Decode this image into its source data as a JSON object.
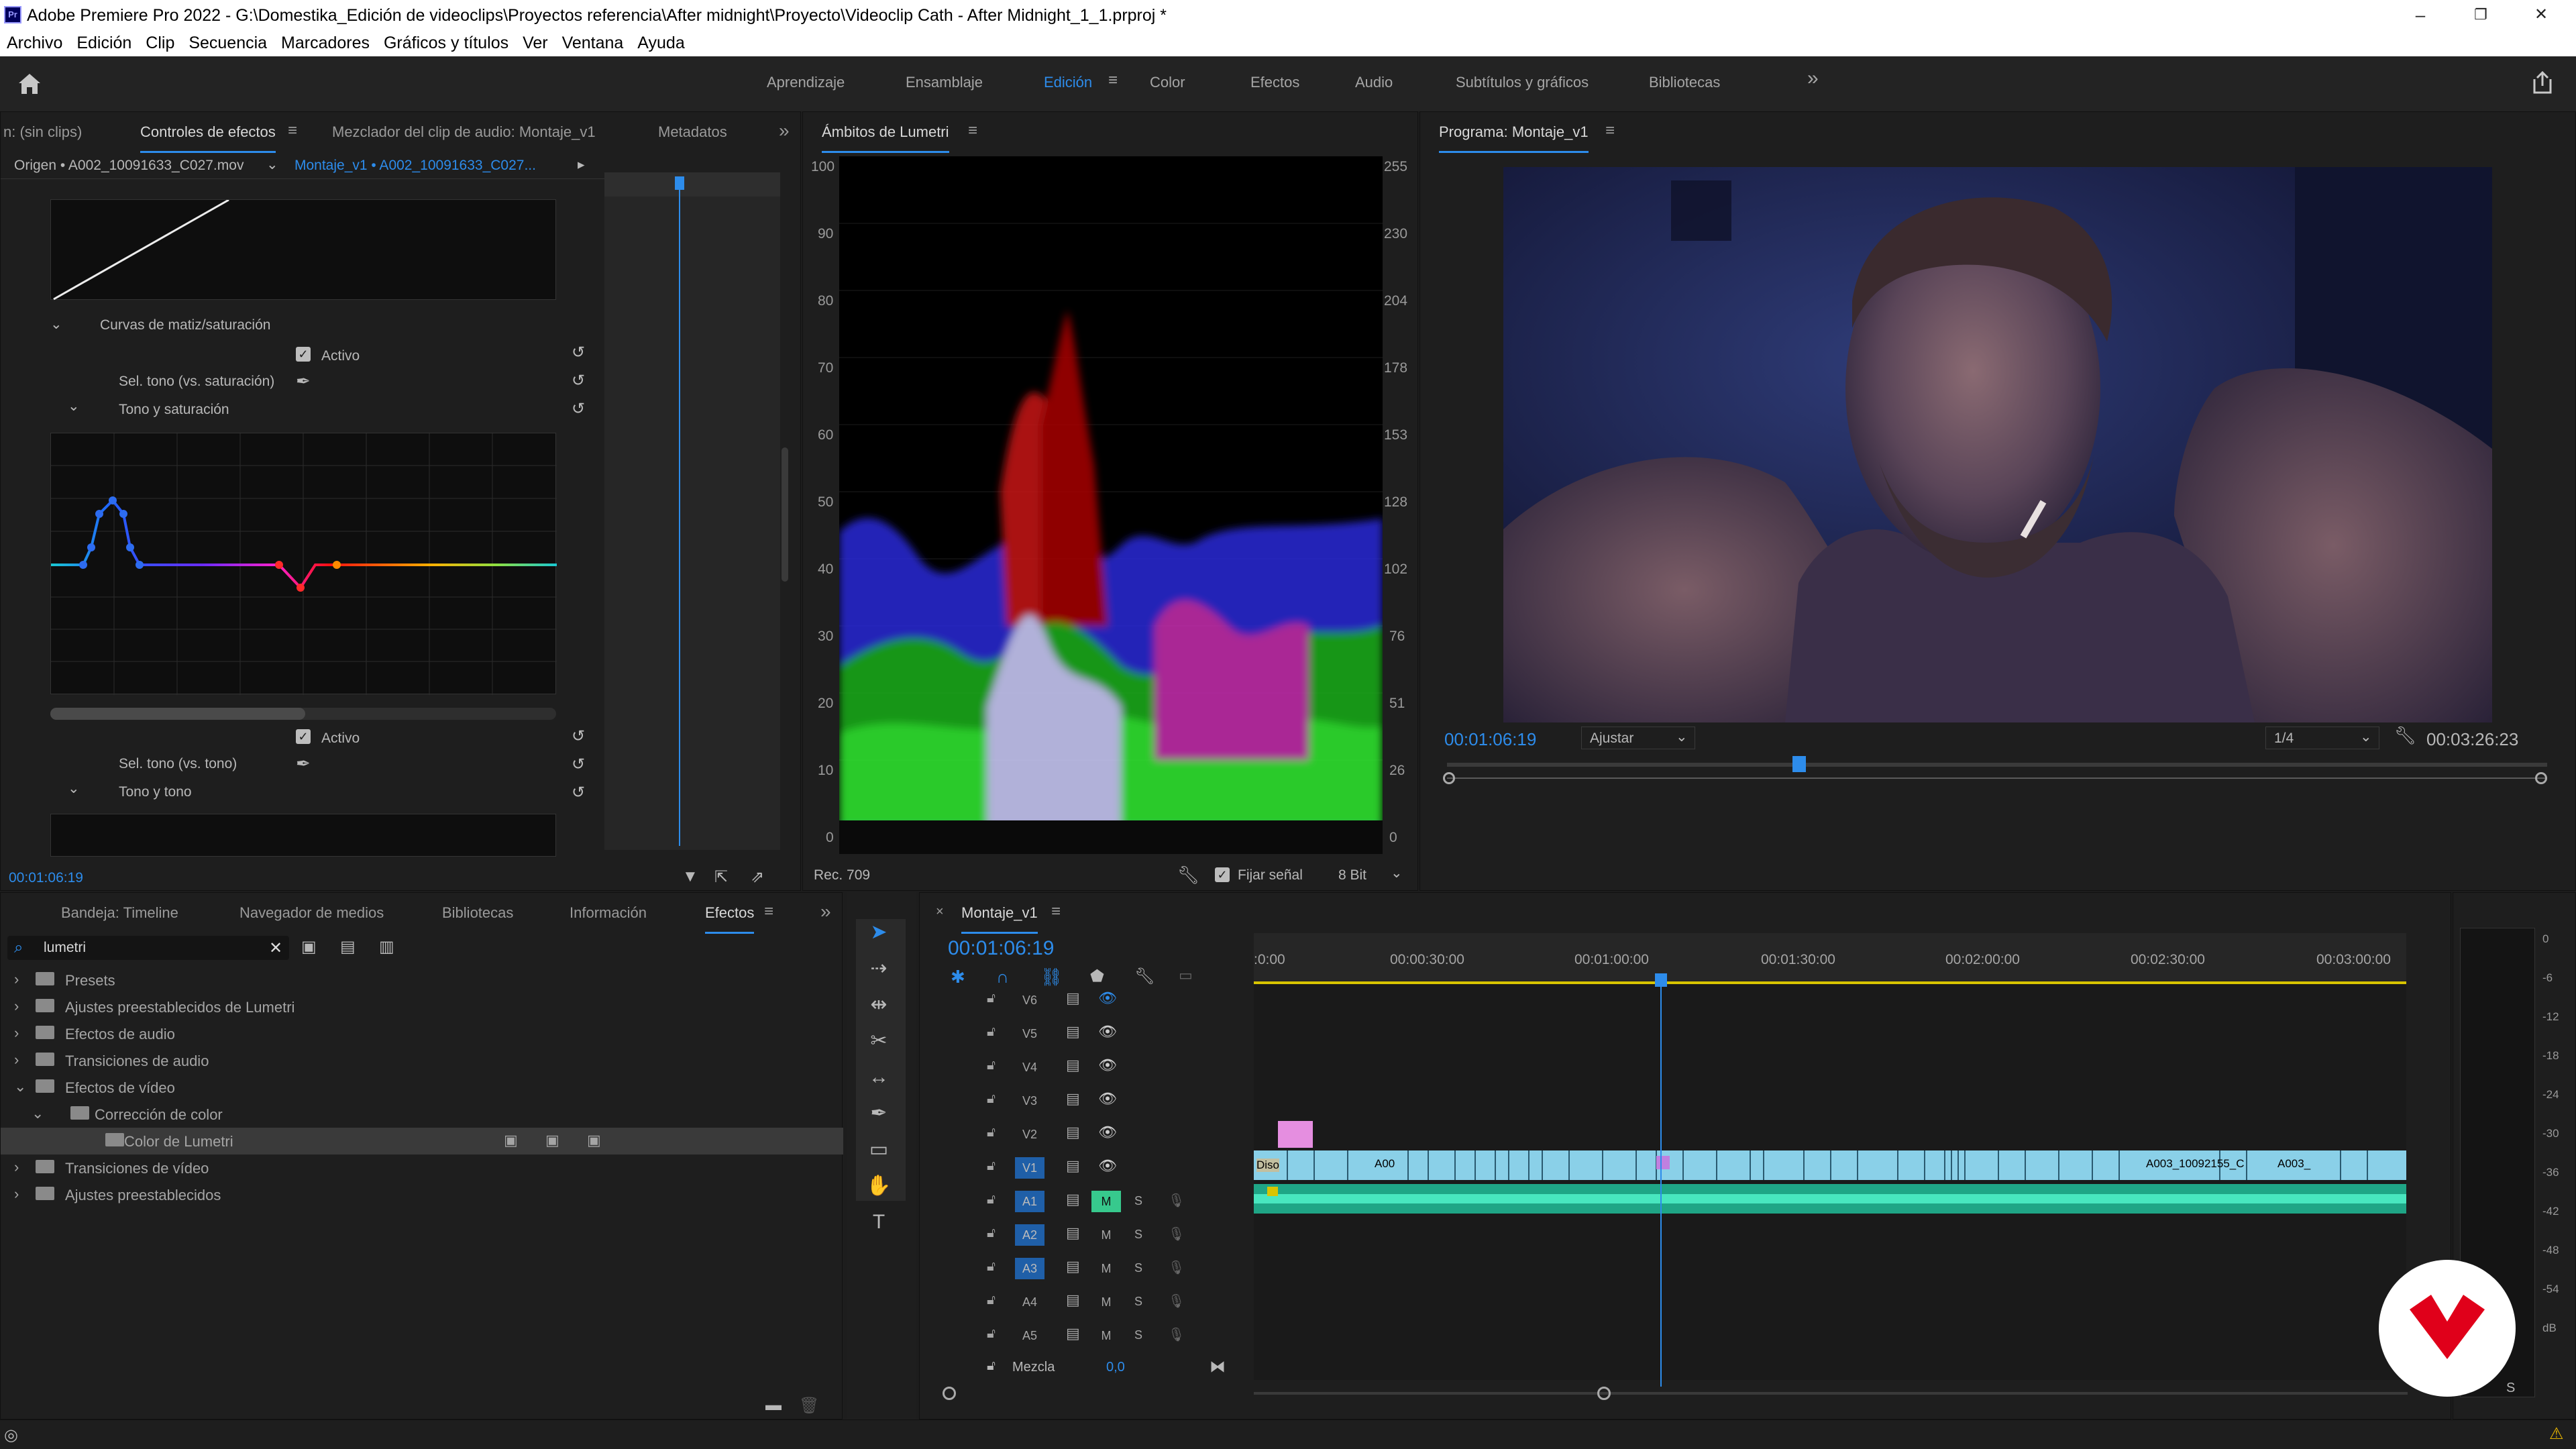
{
  "titlebar": {
    "app_badge": "Pr",
    "title": "Adobe Premiere Pro 2022 - G:\\Domestika_Edición de videoclips\\Proyectos referencia\\After midnight\\Proyecto\\Videoclip Cath - After Midnight_1_1.prproj *",
    "min": "–",
    "max": "❐",
    "close": "✕"
  },
  "menu": [
    "Archivo",
    "Edición",
    "Clip",
    "Secuencia",
    "Marcadores",
    "Gráficos y títulos",
    "Ver",
    "Ventana",
    "Ayuda"
  ],
  "workspaces": {
    "items": [
      "Aprendizaje",
      "Ensamblaje",
      "Edición",
      "Color",
      "Efectos",
      "Audio",
      "Subtítulos y gráficos",
      "Bibliotecas"
    ],
    "active": "Edición",
    "more": "»"
  },
  "effects_panel": {
    "tabs": [
      "n: (sin clips)",
      "Controles de efectos",
      "Mezclador del clip de audio: Montaje_v1",
      "Metadatos"
    ],
    "source_label": "Origen • A002_10091633_C027.mov",
    "sequence_label": "Montaje_v1 • A002_10091633_C027...",
    "section_hue_sat": "Curvas de matiz/saturación",
    "active_label": "Activo",
    "sel_tone_sat": "Sel. tono (vs. saturación)",
    "tone_sat": "Tono y saturación",
    "active_label_2": "Activo",
    "sel_tone_tone": "Sel. tono (vs. tono)",
    "tone_tone": "Tono y tono",
    "timecode": "00:01:06:19"
  },
  "lumetri": {
    "tab": "Ámbitos de Lumetri",
    "left_axis": [
      "100",
      "90",
      "80",
      "70",
      "60",
      "50",
      "40",
      "30",
      "20",
      "10",
      "0"
    ],
    "right_axis": [
      "255",
      "230",
      "204",
      "178",
      "153",
      "128",
      "102",
      "76",
      "51",
      "26",
      "0"
    ],
    "rec": "Rec. 709",
    "clamp_label": "Fijar señal",
    "bit_depth": "8 Bit"
  },
  "program": {
    "tab": "Programa: Montaje_v1",
    "timecode": "00:01:06:19",
    "fit": "Ajustar",
    "resolution": "1/4",
    "duration": "00:03:26:23",
    "playhead_fraction": 0.32
  },
  "project_panel": {
    "tabs": [
      "Bandeja: Timeline",
      "Navegador de medios",
      "Bibliotecas",
      "Información",
      "Efectos"
    ],
    "active_tab": "Efectos",
    "search": "lumetri",
    "tree": [
      {
        "label": "Presets",
        "indent": 0,
        "type": "folder",
        "expanded": false
      },
      {
        "label": "Ajustes preestablecidos de Lumetri",
        "indent": 0,
        "type": "folder",
        "expanded": false
      },
      {
        "label": "Efectos de audio",
        "indent": 0,
        "type": "folder",
        "expanded": false
      },
      {
        "label": "Transiciones de audio",
        "indent": 0,
        "type": "folder",
        "expanded": false
      },
      {
        "label": "Efectos de vídeo",
        "indent": 0,
        "type": "folder",
        "expanded": true
      },
      {
        "label": "Corrección de color",
        "indent": 1,
        "type": "folder",
        "expanded": true
      },
      {
        "label": "Color de Lumetri",
        "indent": 2,
        "type": "effect",
        "selected": true
      },
      {
        "label": "Transiciones de vídeo",
        "indent": 0,
        "type": "folder",
        "expanded": false
      },
      {
        "label": "Ajustes preestablecidos",
        "indent": 0,
        "type": "folder",
        "expanded": false
      }
    ]
  },
  "timeline": {
    "tab": "Montaje_v1",
    "timecode": "00:01:06:19",
    "ruler": [
      ":0:00",
      "00:00:30:00",
      "00:01:00:00",
      "00:01:30:00",
      "00:02:00:00",
      "00:02:30:00",
      "00:03:00:00"
    ],
    "video_tracks": [
      "V6",
      "V5",
      "V4",
      "V3",
      "V2",
      "V1"
    ],
    "audio_tracks": [
      "A1",
      "A2",
      "A3",
      "A4",
      "A5"
    ],
    "mix_label": "Mezcla",
    "mix_value": "0,0",
    "clip_labels": [
      "Diso",
      "A00",
      "A003_10092155_C",
      "A003_"
    ],
    "m_label": "M",
    "s_label": "S"
  },
  "meter": {
    "labels": [
      "0",
      "-6",
      "-12",
      "-18",
      "-24",
      "-30",
      "-36",
      "-42",
      "-48",
      "-54",
      "dB"
    ],
    "s_label": "S"
  },
  "colors": {
    "accent": "#2d8ceb",
    "video_clip": "#8ad0e8",
    "audio_clip": "#2fc9a4",
    "pink_clip": "#e58ee0",
    "brand": "#e0001a"
  }
}
